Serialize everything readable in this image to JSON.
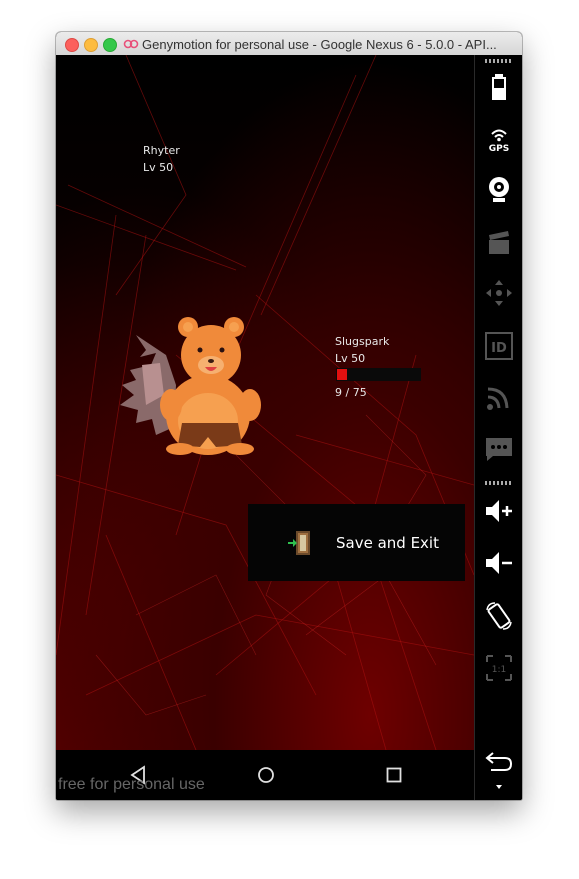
{
  "window": {
    "title": "Genymotion for personal use - Google Nexus 6 - 5.0.0 - API..."
  },
  "game": {
    "trainer": {
      "name": "Rhyter",
      "level": "Lv 50"
    },
    "pokemon": {
      "name": "Slugspark",
      "level": "Lv 50",
      "hp_text": "9 / 75",
      "hp_fraction": 0.12
    },
    "menu": {
      "save_label": "Save and Exit",
      "icon": "door-exit-icon"
    }
  },
  "navbar": {
    "watermark": "free for personal use",
    "buttons": [
      "back-icon",
      "home-icon",
      "recents-icon"
    ]
  },
  "sidebar": {
    "icons": [
      "battery-icon",
      "gps-icon",
      "webcam-icon",
      "capture-icon",
      "dpad-icon",
      "device-id-icon",
      "network-icon",
      "sms-icon",
      "volume-up-icon",
      "volume-down-icon",
      "rotate-icon",
      "scale-icon",
      "back-icon"
    ],
    "gps_label": "GPS",
    "id_label": "ID",
    "scale_label": "1:1"
  },
  "colors": {
    "hp": "#e01010",
    "background_red": "#6e0000"
  }
}
